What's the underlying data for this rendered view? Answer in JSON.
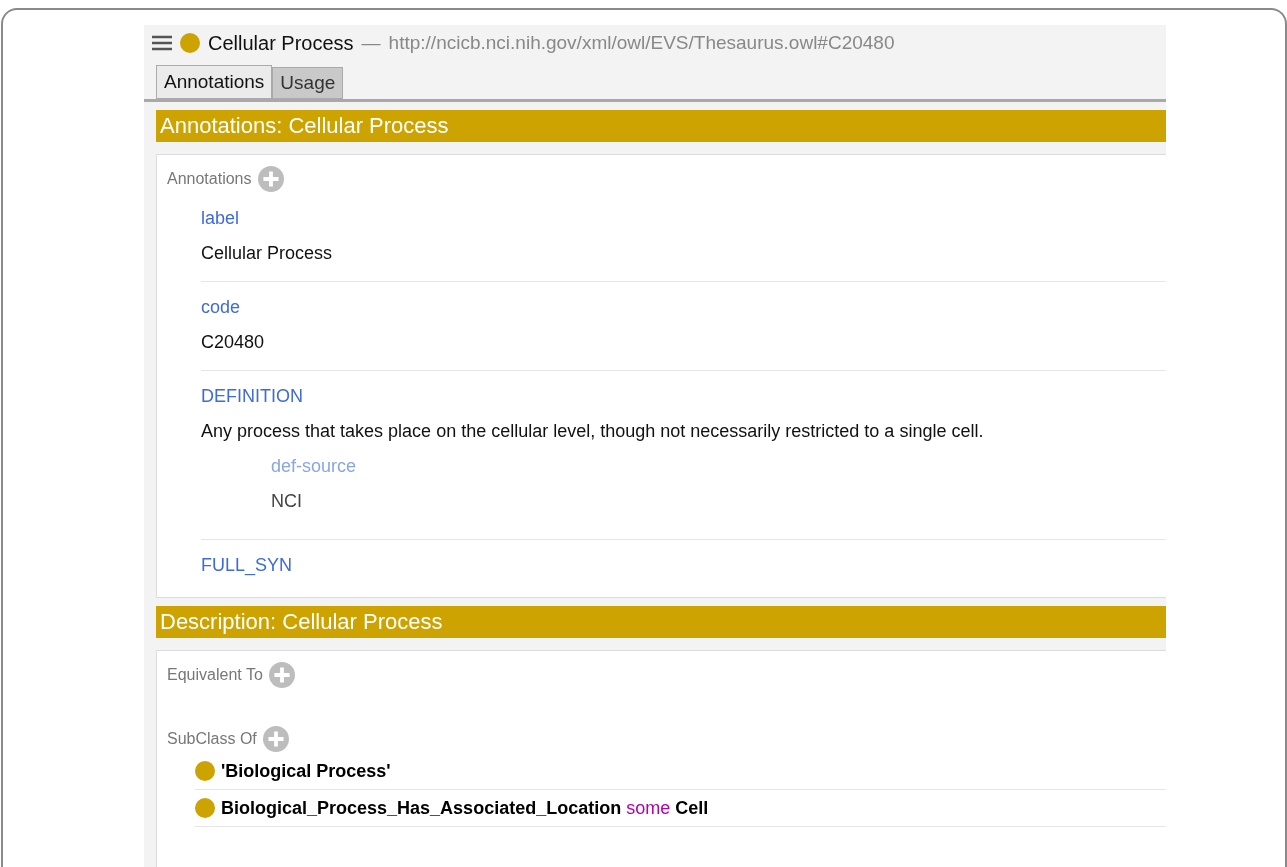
{
  "header": {
    "entity": "Cellular Process",
    "separator": "—",
    "iri": "http://ncicb.nci.nih.gov/xml/owl/EVS/Thesaurus.owl#C20480"
  },
  "tabs": [
    {
      "label": "Annotations",
      "selected": true
    },
    {
      "label": "Usage",
      "selected": false
    }
  ],
  "annotations_section": {
    "title": "Annotations: Cellular Process",
    "frame_label": "Annotations",
    "items": [
      {
        "property": "label",
        "value": "Cellular Process"
      },
      {
        "property": "code",
        "value": "C20480"
      },
      {
        "property": "DEFINITION",
        "value": "Any process that takes place on the cellular level, though not necessarily restricted to a single cell.",
        "sub": [
          {
            "property": "def-source",
            "value": "NCI"
          }
        ]
      },
      {
        "property": "FULL_SYN"
      }
    ]
  },
  "description_section": {
    "title": "Description: Cellular Process",
    "frames": [
      {
        "label": "Equivalent To"
      },
      {
        "label": "SubClass Of",
        "items": [
          {
            "parts": [
              {
                "kind": "entity",
                "text": "'Biological Process'"
              }
            ]
          },
          {
            "parts": [
              {
                "kind": "entity",
                "text": "Biological_Process_Has_Associated_Location"
              },
              {
                "kind": "keyword",
                "text": "some"
              },
              {
                "kind": "entity",
                "text": "Cell"
              }
            ]
          }
        ]
      }
    ]
  }
}
